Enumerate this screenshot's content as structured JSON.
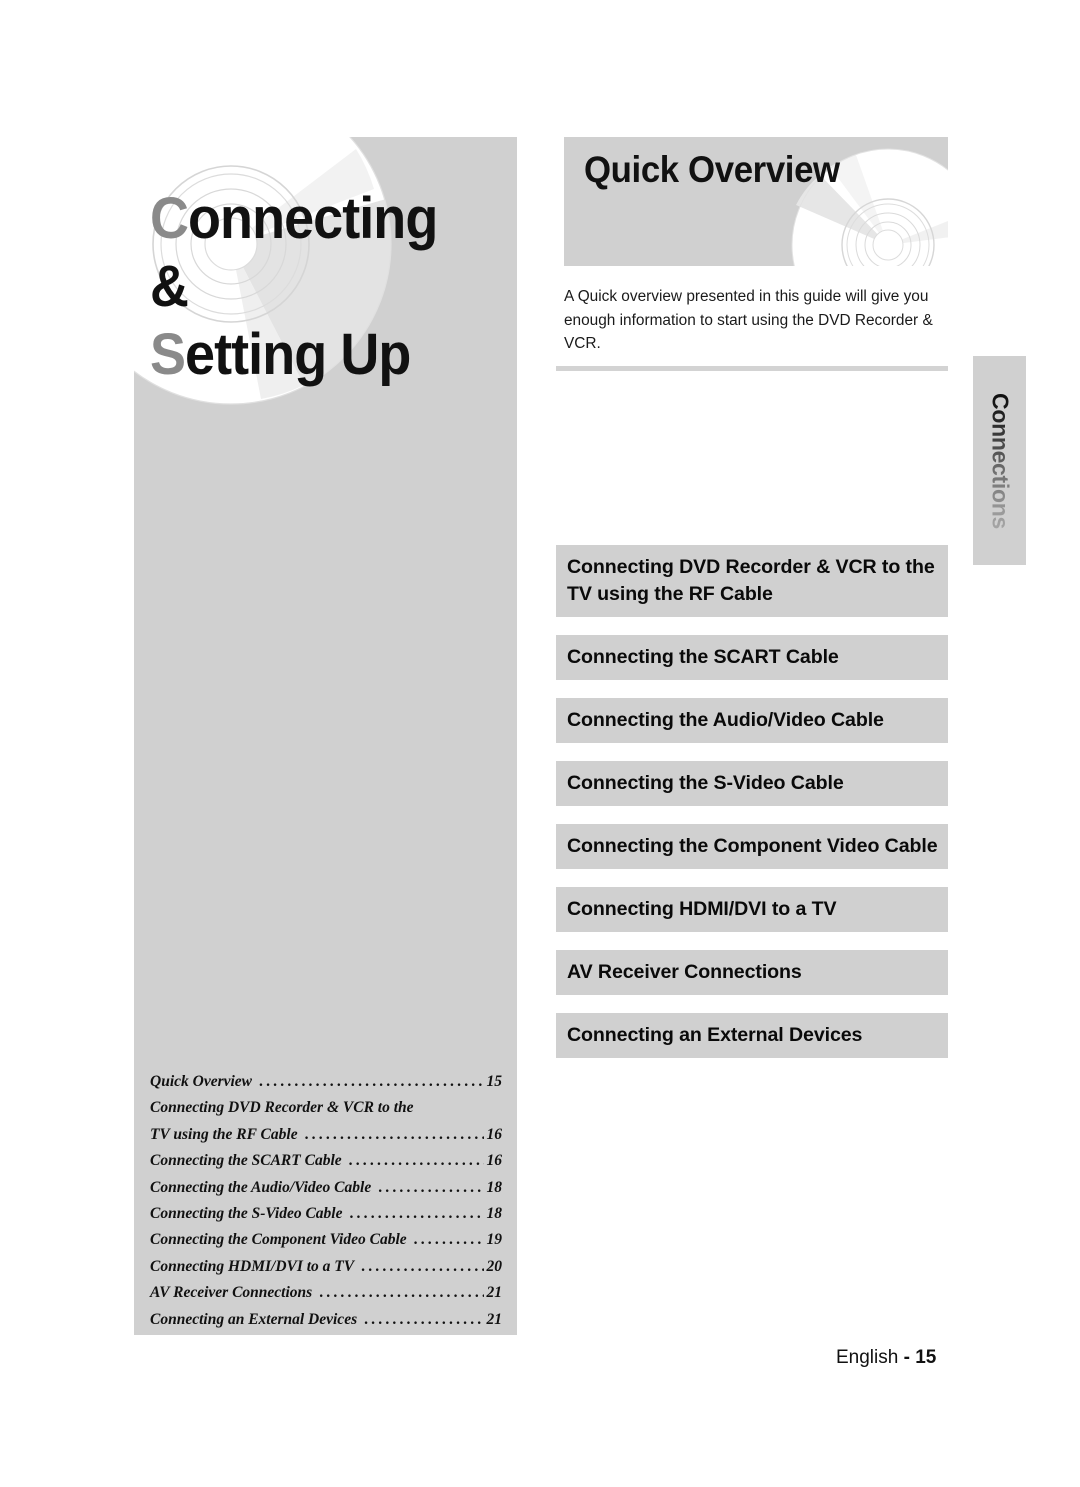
{
  "page": {
    "title_line1": "Connecting &",
    "title_line2": "Setting Up",
    "footer_language": "English",
    "footer_page": "- 15"
  },
  "overview": {
    "heading": "Quick Overview",
    "body": "A Quick overview presented in this guide will give you enough information to start using the DVD Recorder & VCR."
  },
  "side_tab": {
    "label": "Connections"
  },
  "sections": [
    {
      "label": "Connecting DVD Recorder & VCR to the\nTV using the RF Cable"
    },
    {
      "label": "Connecting the SCART Cable"
    },
    {
      "label": "Connecting the Audio/Video Cable"
    },
    {
      "label": "Connecting the S-Video Cable"
    },
    {
      "label": "Connecting the Component Video Cable"
    },
    {
      "label": "Connecting HDMI/DVI to a TV"
    },
    {
      "label": "AV Receiver Connections"
    },
    {
      "label": "Connecting an External Devices"
    }
  ],
  "toc": [
    {
      "label": "Quick Overview",
      "page": "15",
      "dots": true
    },
    {
      "label": "Connecting DVD Recorder & VCR to the",
      "page": "",
      "dots": false
    },
    {
      "label": "TV using the RF Cable",
      "page": "16",
      "dots": true
    },
    {
      "label": "Connecting the SCART Cable",
      "page": "16",
      "dots": true
    },
    {
      "label": "Connecting the Audio/Video Cable",
      "page": "18",
      "dots": true
    },
    {
      "label": "Connecting the S-Video Cable",
      "page": "18",
      "dots": true
    },
    {
      "label": "Connecting the Component Video Cable",
      "page": "19",
      "dots": true
    },
    {
      "label": "Connecting HDMI/DVI to a TV",
      "page": "20",
      "dots": true
    },
    {
      "label": "AV Receiver Connections",
      "page": "21",
      "dots": true
    },
    {
      "label": "Connecting an External Devices",
      "page": "21",
      "dots": true
    }
  ],
  "colors": {
    "panel_gray": "#d0d0d0",
    "rule_gray": "#d3d3d3",
    "text_black": "#111111",
    "title_faded_gray": "#8a8a8a"
  }
}
